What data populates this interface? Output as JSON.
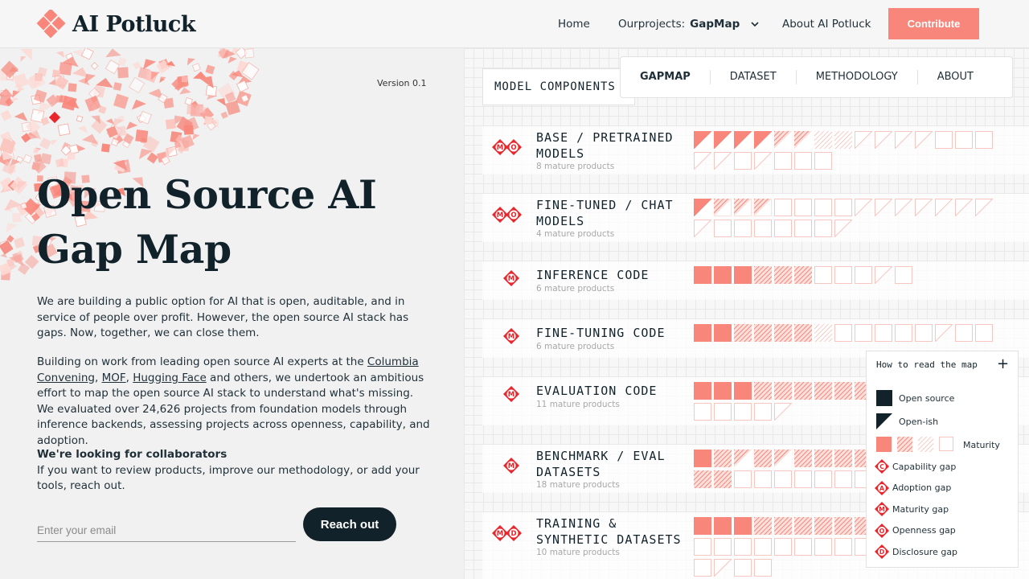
{
  "brand": {
    "name": "AI Potluck"
  },
  "nav": {
    "home": "Home",
    "projects_label": "Ourprojects:",
    "projects_value": "GapMap",
    "about": "About AI Potluck",
    "contribute": "Contribute"
  },
  "hero": {
    "version": "Version 0.1",
    "title_line1": "Open Source AI",
    "title_line2": "Gap Map",
    "para1": "We are building a public option for AI that is open, auditable, and in service of people over profit. However, the open source AI stack has gaps. Now, together, we can close them.",
    "para2_before": "Building on work from leading open source AI experts at the ",
    "link_columbia": "Columbia Convening",
    "sep1": ", ",
    "link_mof": "MOF",
    "sep2": ", ",
    "link_hf": "Hugging Face",
    "para2_after": " and others, we undertook an ambitious effort to map the open source AI stack to understand what's missing. We evaluated over 24,626 projects from foundation models through inference backends, assessing projects across openness, capability, and adoption.",
    "collab_heading": "We're looking for collaborators",
    "collab_text": "If you want to review products, improve our methodology, or add your tools, reach out.",
    "email_placeholder": "Enter your email",
    "reach_out": "Reach out"
  },
  "subnav": {
    "tabs": [
      "GAPMAP",
      "DATASET",
      "METHODOLOGY",
      "ABOUT"
    ]
  },
  "map": {
    "header": "MODEL COMPONENTS",
    "rows": [
      {
        "line1": "BASE / PRETRAINED",
        "line2": "MODELS",
        "sub": "8 mature products",
        "gaps": [
          "M",
          "O"
        ],
        "cells": [
          [
            "open-ish",
            "open-ish",
            "open-ish",
            "open-ish",
            "open-ish-hatch",
            "open-ish-hatch",
            "hatch-light",
            "hatch-light",
            "outline-tri",
            "outline-tri",
            "outline-tri",
            "outline-tri",
            "outline",
            "outline",
            "outline"
          ],
          [
            "outline-tri",
            "outline-tri",
            "outline",
            "outline-tri",
            "outline",
            "outline",
            "outline"
          ]
        ]
      },
      {
        "line1": "FINE-TUNED / CHAT",
        "line2": "MODELS",
        "sub": "4 mature products",
        "gaps": [
          "M",
          "O"
        ],
        "cells": [
          [
            "open-ish",
            "hatch-tri",
            "hatch-tri",
            "hatch-tri",
            "outline",
            "outline",
            "outline",
            "outline",
            "outline-tri",
            "outline-tri",
            "outline-tri",
            "outline-tri",
            "outline-tri",
            "outline-tri",
            "outline-tri"
          ],
          [
            "outline-tri",
            "outline",
            "outline",
            "outline",
            "outline",
            "outline",
            "outline",
            "outline-tri"
          ]
        ]
      },
      {
        "line1": "INFERENCE CODE",
        "line2": "",
        "sub": "6 mature products",
        "gaps": [
          "M"
        ],
        "cells": [
          [
            "solid",
            "solid",
            "solid",
            "hatch",
            "hatch",
            "hatch",
            "outline",
            "outline",
            "outline",
            "outline-tri",
            "outline"
          ]
        ]
      },
      {
        "line1": "FINE-TUNING CODE",
        "line2": "",
        "sub": "6 mature products",
        "gaps": [
          "M"
        ],
        "cells": [
          [
            "solid",
            "solid",
            "hatch",
            "hatch",
            "hatch",
            "hatch",
            "hatch-light",
            "outline",
            "outline",
            "outline",
            "outline",
            "outline",
            "outline-tri",
            "outline",
            "outline"
          ]
        ]
      },
      {
        "line1": "EVALUATION CODE",
        "line2": "",
        "sub": "11 mature products",
        "gaps": [
          "M"
        ],
        "cells": [
          [
            "solid",
            "solid",
            "solid",
            "hatch",
            "hatch",
            "hatch",
            "hatch",
            "hatch",
            "hatch",
            "hatch"
          ],
          [
            "outline",
            "outline",
            "outline",
            "outline",
            "outline-tri"
          ]
        ]
      },
      {
        "line1": "BENCHMARK / EVAL",
        "line2": "DATASETS",
        "sub": "18 mature products",
        "gaps": [
          "M"
        ],
        "cells": [
          [
            "solid",
            "hatch",
            "open-ish-hatch",
            "hatch",
            "open-ish-hatch",
            "hatch",
            "hatch",
            "hatch",
            "hatch",
            "hatch"
          ],
          [
            "hatch",
            "hatch",
            "outline",
            "outline",
            "outline",
            "outline",
            "outline",
            "outline",
            "outline",
            "outline"
          ]
        ]
      },
      {
        "line1": "TRAINING &",
        "line2": "SYNTHETIC DATASETS",
        "sub": "10 mature products",
        "gaps": [
          "M",
          "D"
        ],
        "cells": [
          [
            "solid",
            "solid",
            "solid",
            "hatch",
            "hatch",
            "hatch",
            "hatch",
            "hatch",
            "hatch",
            "hatch"
          ],
          [
            "outline",
            "outline",
            "outline",
            "outline",
            "outline",
            "outline",
            "outline",
            "outline",
            "outline",
            "outline"
          ],
          [
            "outline",
            "outline-tri",
            "outline",
            "outline"
          ]
        ]
      }
    ]
  },
  "legend": {
    "title": "How to read the map",
    "plus": "+",
    "open_source": "Open source",
    "open_ish": "Open-ish",
    "maturity": "Maturity",
    "capability": "Capability gap",
    "adoption": "Adoption gap",
    "maturity_gap": "Maturity gap",
    "openness": "Openness gap",
    "disclosure": "Disclosure gap",
    "letters": [
      "C",
      "A",
      "M",
      "O",
      "D"
    ]
  },
  "colors": {
    "accent": "#f9867a",
    "dark": "#12222b",
    "gap_red": "#e8262b"
  }
}
